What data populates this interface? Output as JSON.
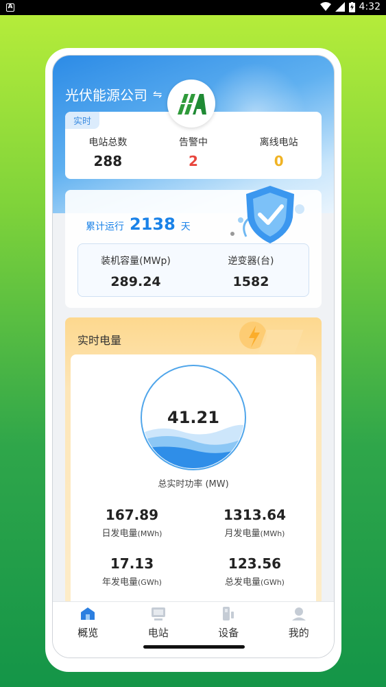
{
  "status_bar": {
    "time": "4:32"
  },
  "header": {
    "company": "光伏能源公司",
    "switch_symbol": "⇋"
  },
  "realtime": {
    "tag": "实时",
    "items": [
      {
        "label": "电站总数",
        "value": "288",
        "color": "#222222"
      },
      {
        "label": "告警中",
        "value": "2",
        "color": "#e8463d"
      },
      {
        "label": "离线电站",
        "value": "0",
        "color": "#f0b324"
      }
    ]
  },
  "running": {
    "label": "累计运行",
    "days": "2138",
    "unit": "天",
    "stats": [
      {
        "label": "装机容量(MWp)",
        "value": "289.24"
      },
      {
        "label": "逆变器(台)",
        "value": "1582"
      }
    ]
  },
  "energy": {
    "title": "实时电量",
    "gauge_value": "41.21",
    "gauge_label": "总实时功率 (MW)",
    "items": [
      {
        "value": "167.89",
        "label": "日发电量",
        "unit": "(MWh)"
      },
      {
        "value": "1313.64",
        "label": "月发电量",
        "unit": "(MWh)"
      },
      {
        "value": "17.13",
        "label": "年发电量",
        "unit": "(GWh)"
      },
      {
        "value": "123.56",
        "label": "总发电量",
        "unit": "(GWh)"
      }
    ]
  },
  "tabs": [
    {
      "label": "概览",
      "icon": "home-icon",
      "active": true
    },
    {
      "label": "电站",
      "icon": "station-icon",
      "active": false
    },
    {
      "label": "设备",
      "icon": "device-icon",
      "active": false
    },
    {
      "label": "我的",
      "icon": "user-icon",
      "active": false
    }
  ],
  "colors": {
    "primary": "#1a82e8",
    "alert": "#e8463d",
    "warning": "#f0b324"
  }
}
